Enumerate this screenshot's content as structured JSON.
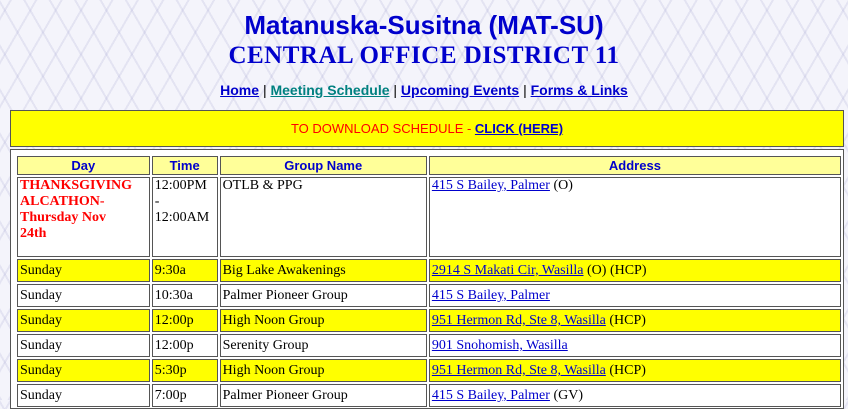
{
  "header": {
    "title": "Matanuska-Susitna (MAT-SU)",
    "subtitle": "CENTRAL OFFICE DISTRICT 11"
  },
  "nav": {
    "items": [
      "Home",
      "Meeting Schedule",
      "Upcoming Events",
      "Forms & Links"
    ],
    "separator": "|"
  },
  "download": {
    "label": "TO DOWNLOAD SCHEDULE - ",
    "link": "CLICK (HERE)"
  },
  "table": {
    "headers": [
      "Day",
      "Time",
      "Group Name",
      "Address"
    ],
    "special": {
      "day_line1": "THANKSGIVING",
      "day_line2": "ALCATHON-",
      "day_line3": "Thursday Nov",
      "day_line4": "24th",
      "time_start": "12:00PM",
      "time_dash": "-",
      "time_end": "12:00AM",
      "group": "OTLB & PPG",
      "address": "415 S Bailey, Palmer",
      "address_note": " (O)"
    },
    "rows": [
      {
        "day": "Sunday",
        "time": "9:30a",
        "group": "Big Lake Awakenings",
        "address": "2914 S Makati Cir, Wasilla",
        "note": " (O) (HCP)"
      },
      {
        "day": "Sunday",
        "time": "10:30a",
        "group": "Palmer Pioneer Group",
        "address": "415 S Bailey, Palmer",
        "note": ""
      },
      {
        "day": "Sunday",
        "time": "12:00p",
        "group": "High Noon Group",
        "address": "951 Hermon Rd, Ste 8, Wasilla",
        "note": " (HCP)"
      },
      {
        "day": "Sunday",
        "time": "12:00p",
        "group": "Serenity Group",
        "address": "901 Snohomish, Wasilla",
        "note": ""
      },
      {
        "day": "Sunday",
        "time": "5:30p",
        "group": "High Noon Group",
        "address": "951 Hermon Rd, Ste 8, Wasilla",
        "note": " (HCP)"
      },
      {
        "day": "Sunday",
        "time": "7:00p",
        "group": "Palmer Pioneer Group",
        "address": "415 S Bailey, Palmer",
        "note": " (GV)"
      }
    ]
  },
  "colors": {
    "title": "#0000cc",
    "row_highlight": "#ffff00",
    "header_bg": "#ffff99",
    "special_text": "#ff0000",
    "visited_link": "#008080"
  }
}
